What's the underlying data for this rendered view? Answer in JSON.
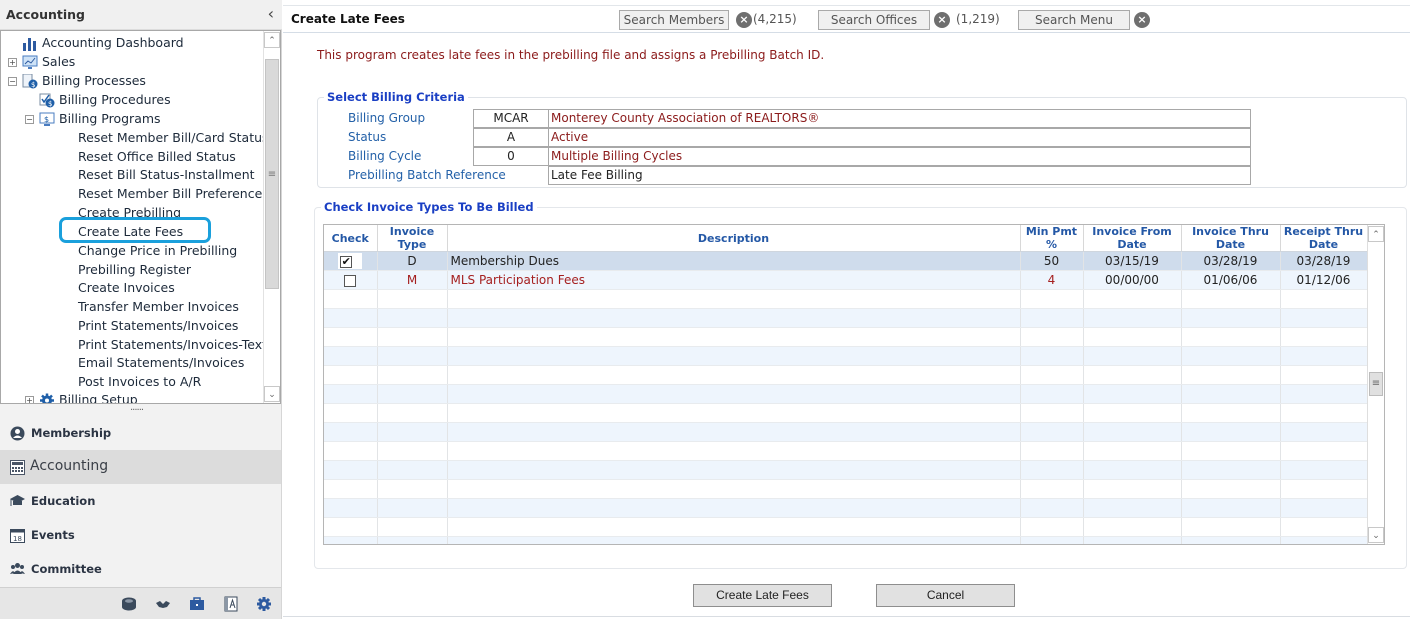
{
  "sidebar": {
    "title": "Accounting",
    "collapse_icon": "chevron-left-icon",
    "tree": [
      {
        "label": "Accounting Dashboard",
        "icon": "bar-chart-icon"
      },
      {
        "label": "Sales",
        "icon": "monitor-chart-icon",
        "expander": "+"
      },
      {
        "label": "Billing Processes",
        "icon": "document-dollar-icon",
        "expander": "−"
      },
      {
        "label": "Billing Procedures",
        "icon": "checklist-dollar-icon"
      },
      {
        "label": "Billing Programs",
        "icon": "monitor-dollar-icon",
        "expander": "−"
      },
      {
        "label": "Reset Member Bill/Card Status"
      },
      {
        "label": "Reset Office Billed Status"
      },
      {
        "label": "Reset Bill Status-Installment"
      },
      {
        "label": "Reset Member Bill Preference"
      },
      {
        "label": "Create Prebilling"
      },
      {
        "label": "Create Late Fees",
        "highlighted": true
      },
      {
        "label": "Change Price in Prebilling"
      },
      {
        "label": "Prebilling Register"
      },
      {
        "label": "Create Invoices"
      },
      {
        "label": "Transfer Member Invoices"
      },
      {
        "label": "Print Statements/Invoices"
      },
      {
        "label": "Print Statements/Invoices-Text"
      },
      {
        "label": "Email Statements/Invoices"
      },
      {
        "label": "Post Invoices to A/R"
      },
      {
        "label": "Billing Setup",
        "icon": "gear-icon",
        "expander": "+"
      }
    ],
    "grip": "......",
    "nav": [
      {
        "label": "Membership",
        "icon": "user-circle-icon"
      },
      {
        "label": "Accounting",
        "icon": "calculator-icon",
        "active": true
      },
      {
        "label": "Education",
        "icon": "graduation-cap-icon"
      },
      {
        "label": "Events",
        "icon": "calendar-icon"
      },
      {
        "label": "Committee",
        "icon": "group-icon"
      }
    ],
    "bottom_icons": [
      "coins-icon",
      "handshake-icon",
      "briefcase-icon",
      "contact-book-icon",
      "gear-icon"
    ]
  },
  "header": {
    "title": "Create Late Fees",
    "search_members": "Search Members",
    "members_count": "(4,215)",
    "search_offices": "Search Offices",
    "offices_count": "(1,219)",
    "search_menu": "Search Menu"
  },
  "intro": "This program creates late fees in the prebilling file and assigns a Prebilling Batch ID.",
  "criteria": {
    "legend": "Select Billing Criteria",
    "rows": [
      {
        "label": "Billing Group",
        "code": "MCAR",
        "desc": "Monterey County Association of REALTORS®"
      },
      {
        "label": "Status",
        "code": "A",
        "desc": "Active"
      },
      {
        "label": "Billing Cycle",
        "code": "0",
        "desc": "Multiple Billing Cycles"
      },
      {
        "label": "Prebilling Batch Reference",
        "desc": "Late Fee Billing"
      }
    ]
  },
  "invoice_types": {
    "legend": "Check Invoice Types To Be Billed",
    "columns": [
      "Check",
      "Invoice Type",
      "Description",
      "Min Pmt %",
      "Invoice From Date",
      "Invoice Thru Date",
      "Receipt Thru Date"
    ],
    "rows": [
      {
        "checked": true,
        "type": "D",
        "description": "Membership Dues",
        "min_pmt": "50",
        "from": "03/15/19",
        "thru": "03/28/19",
        "receipt": "03/28/19"
      },
      {
        "checked": false,
        "type": "M",
        "description": "MLS Participation Fees",
        "min_pmt": "4",
        "from": "00/00/00",
        "thru": "01/06/06",
        "receipt": "01/12/06"
      }
    ]
  },
  "actions": {
    "create": "Create Late Fees",
    "cancel": "Cancel"
  },
  "colors": {
    "accent_blue": "#1a3fc4",
    "label_blue": "#2461a8",
    "text_red": "#8b1a1a",
    "highlight_ring": "#1aa0dc",
    "selected_row": "#cfdcec"
  }
}
